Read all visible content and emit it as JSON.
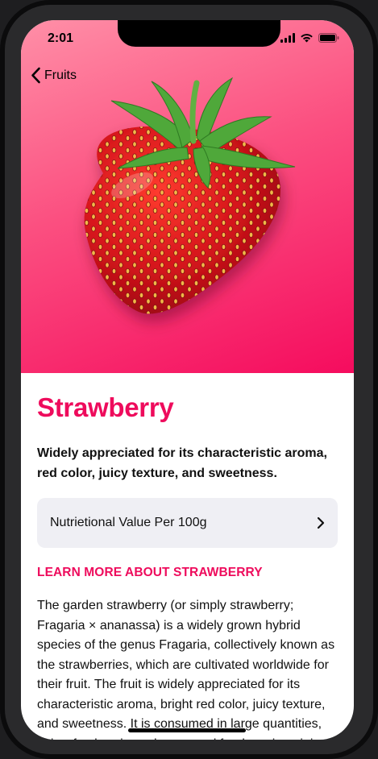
{
  "status_bar": {
    "time": "2:01"
  },
  "nav": {
    "back_label": "Fruits"
  },
  "fruit": {
    "title": "Strawberry",
    "headline": "Widely appreciated for its characteristic aroma,  red color, juicy texture, and sweetness.",
    "nutrition_label": "Nutrietional Value Per 100g",
    "learn_more": "LEARN MORE ABOUT STRAWBERRY",
    "description": "The garden strawberry (or simply strawberry; Fragaria × ananassa) is a widely grown hybrid species of the genus Fragaria, collectively known as the strawberries, which are cultivated worldwide for their fruit. The fruit is widely appreciated for its characteristic aroma, bright red color, juicy texture, and sweetness. It is consumed in large quantities, either fresh or in such prepared foods as jam, juice, pies, ice cream, milkshakes, and chocolates."
  },
  "colors": {
    "accent": "#EE0B5C",
    "gradient_start": "#FF8FA7",
    "gradient_end": "#F50C5E",
    "card_bg": "#EFEFF4"
  },
  "icons": {
    "back": "chevron-left-icon",
    "row_chevron": "chevron-right-icon",
    "signal": "signal-icon",
    "wifi": "wifi-icon",
    "battery": "battery-icon"
  }
}
